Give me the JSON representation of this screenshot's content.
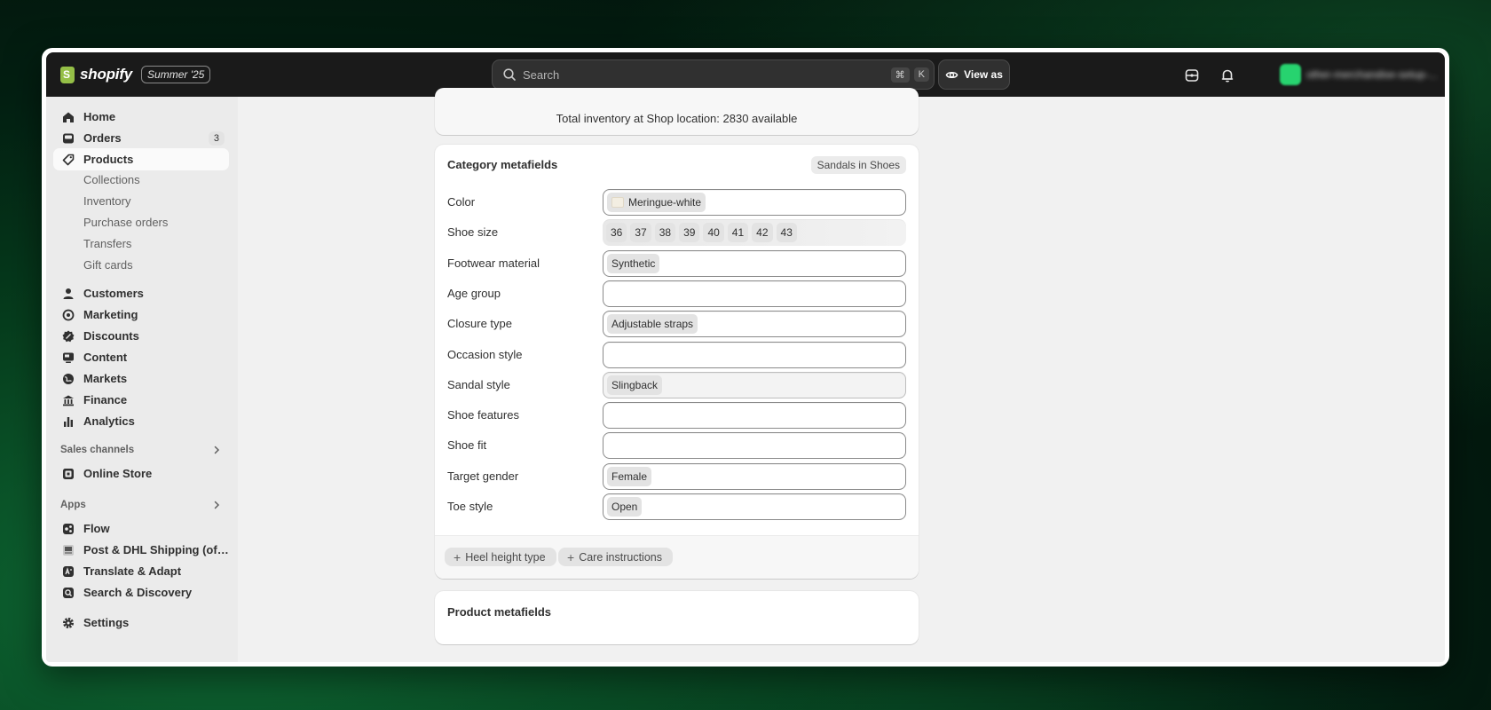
{
  "topbar": {
    "brand": "shopify",
    "edition": "Summer '25",
    "search_placeholder": "Search",
    "shortcut_cmd": "⌘",
    "shortcut_key": "K",
    "view_as": "View as",
    "store_name": "other-merchandise-setup-..."
  },
  "sidebar": {
    "items": [
      {
        "label": "Home",
        "icon": "home-icon"
      },
      {
        "label": "Orders",
        "icon": "inbox-icon",
        "badge": "3"
      },
      {
        "label": "Products",
        "icon": "tag-icon",
        "active": true
      },
      {
        "label": "Customers",
        "icon": "person-icon"
      },
      {
        "label": "Marketing",
        "icon": "target-icon"
      },
      {
        "label": "Discounts",
        "icon": "discount-icon"
      },
      {
        "label": "Content",
        "icon": "content-icon"
      },
      {
        "label": "Markets",
        "icon": "globe-icon"
      },
      {
        "label": "Finance",
        "icon": "bank-icon"
      },
      {
        "label": "Analytics",
        "icon": "bar-chart-icon"
      }
    ],
    "product_subitems": [
      "Collections",
      "Inventory",
      "Purchase orders",
      "Transfers",
      "Gift cards"
    ],
    "sales_channels_title": "Sales channels",
    "sales_channels": [
      {
        "label": "Online Store",
        "icon": "store-icon"
      }
    ],
    "apps_title": "Apps",
    "apps": [
      {
        "label": "Flow",
        "icon": "flow-icon"
      },
      {
        "label": "Post & DHL Shipping (offic...",
        "icon": "shipping-app-icon"
      },
      {
        "label": "Translate & Adapt",
        "icon": "translate-icon"
      },
      {
        "label": "Search & Discovery",
        "icon": "search-discovery-icon"
      }
    ],
    "settings": "Settings"
  },
  "main": {
    "inventory_text": "Total inventory at Shop location: 2830 available",
    "category_title": "Category metafields",
    "category_pill": "Sandals in Shoes",
    "fields": [
      {
        "label": "Color",
        "values": [
          "Meringue-white"
        ],
        "swatch": "#f3eee2"
      },
      {
        "label": "Shoe size",
        "values": [
          "36",
          "37",
          "38",
          "39",
          "40",
          "41",
          "42",
          "43"
        ]
      },
      {
        "label": "Footwear material",
        "values": [
          "Synthetic"
        ]
      },
      {
        "label": "Age group",
        "values": []
      },
      {
        "label": "Closure type",
        "values": [
          "Adjustable straps"
        ]
      },
      {
        "label": "Occasion style",
        "values": []
      },
      {
        "label": "Sandal style",
        "values": [
          "Slingback"
        ]
      },
      {
        "label": "Shoe features",
        "values": []
      },
      {
        "label": "Shoe fit",
        "values": []
      },
      {
        "label": "Target gender",
        "values": [
          "Female"
        ]
      },
      {
        "label": "Toe style",
        "values": [
          "Open"
        ]
      }
    ],
    "add_buttons": [
      "Heel height type",
      "Care instructions"
    ],
    "product_title": "Product metafields"
  }
}
